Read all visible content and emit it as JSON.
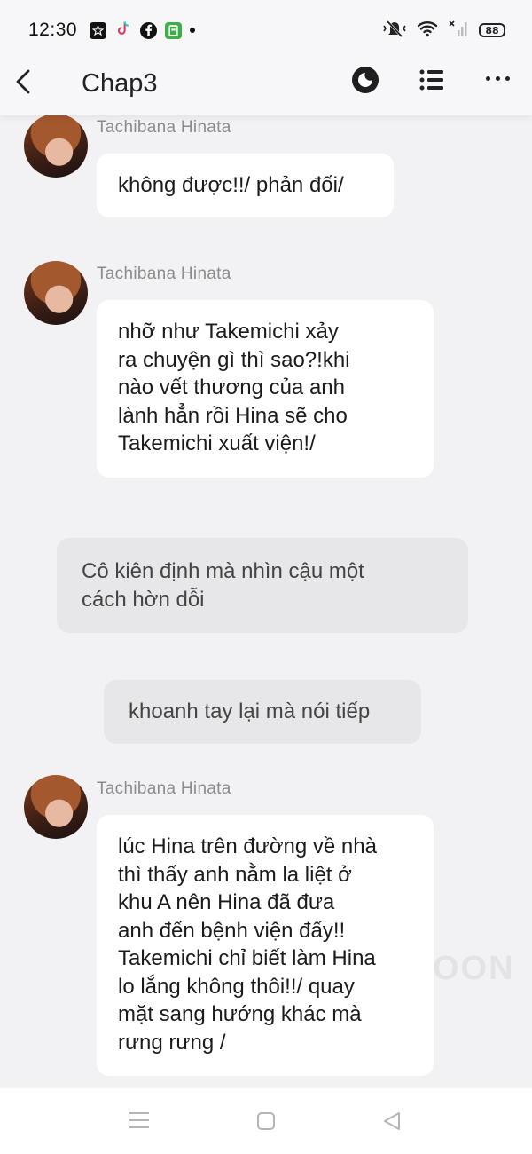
{
  "status_bar": {
    "time": "12:30",
    "left_icons": [
      "star-app-icon",
      "tiktok-icon",
      "facebook-icon",
      "green-app-icon",
      "dot-icon"
    ],
    "right_icons": [
      "mute-bell-icon",
      "wifi-icon",
      "signal-icon"
    ],
    "battery": "88"
  },
  "app_bar": {
    "title": "Chap3",
    "icons": [
      "back-icon",
      "theme-toggle-icon",
      "table-of-contents-icon",
      "more-icon"
    ]
  },
  "messages": [
    {
      "type": "character",
      "sender": "Tachibana Hinata",
      "text": "không được!!/ phản đối/"
    },
    {
      "type": "character",
      "sender": "Tachibana Hinata",
      "lines": [
        "nhỡ như Takemichi xảy",
        "ra chuyện gì thì sao?!khi",
        "nào vết thương của anh",
        "lành hẳn rồi Hina sẽ cho",
        "Takemichi xuất viện!/"
      ]
    },
    {
      "type": "narration",
      "lines": [
        "Cô kiên định mà nhìn cậu một",
        "cách hờn dỗi"
      ]
    },
    {
      "type": "narration",
      "text": "khoanh tay lại mà nói tiếp"
    },
    {
      "type": "character",
      "sender": "Tachibana Hinata",
      "lines": [
        "lúc Hina trên đường về nhà",
        "thì thấy anh nằm la liệt ở",
        "khu A nên Hina đã đưa",
        "anh đến bệnh viện đấy!!",
        "Takemichi chỉ biết làm Hina",
        "lo lắng không thôi!!/ quay",
        "mặt sang hướng khác mà",
        "rưng rưng /"
      ]
    }
  ],
  "watermark": "OON",
  "nav_bar": {
    "icons": [
      "menu-icon",
      "home-icon",
      "back-triangle-icon"
    ]
  }
}
